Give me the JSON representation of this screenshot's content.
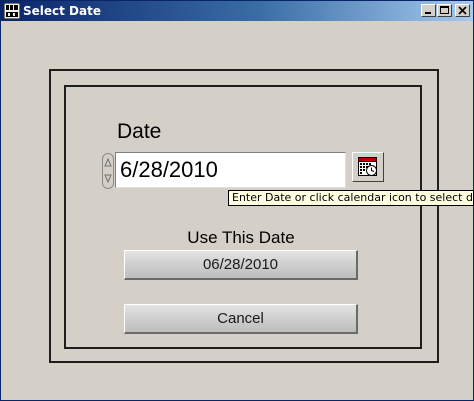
{
  "window": {
    "title": "Select Date",
    "icon": "labview-app-icon"
  },
  "titlebar_buttons": [
    "minimize-icon",
    "maximize-icon",
    "close-icon"
  ],
  "date_section": {
    "label": "Date",
    "value": "6/28/2010",
    "calendar_icon": "calendar-icon",
    "spinner_icon": "spinner-icon"
  },
  "tooltip": {
    "text": "Enter Date or click calendar icon to select date"
  },
  "use_date": {
    "label": "Use This Date",
    "button_label": "06/28/2010"
  },
  "cancel": {
    "button_label": "Cancel"
  },
  "colors": {
    "titlebar_start": "#0a246a",
    "titlebar_end": "#a6caf0",
    "panel": "#d4d0c8",
    "tooltip_bg": "#ffffe1"
  }
}
